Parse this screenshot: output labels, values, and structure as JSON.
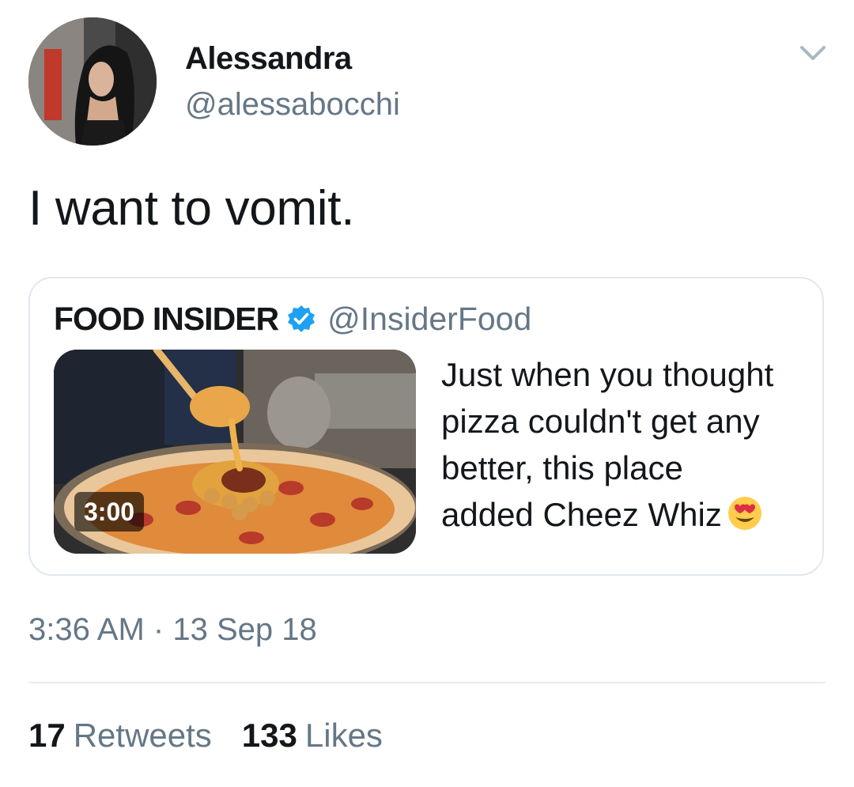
{
  "author": {
    "display_name": "Alessandra",
    "handle": "@alessabocchi",
    "avatar_icon": "profile-photo"
  },
  "menu_icon": "chevron-down-icon",
  "tweet": {
    "text": "I want to vomit."
  },
  "quoted_tweet": {
    "author_name": "FOOD INSIDER",
    "verified": true,
    "verified_icon": "verified-badge-icon",
    "handle": "@InsiderFood",
    "media": {
      "type": "video",
      "duration": "3:00",
      "description_icon": "pizza-video-thumbnail"
    },
    "text_lines": [
      "Just when you thought",
      "pizza couldn't get any",
      "better, this place",
      "added Cheez Whiz"
    ],
    "emoji": "heart-eyes-emoji"
  },
  "timestamp": {
    "time": "3:36 AM",
    "separator": "·",
    "date": "13 Sep 18"
  },
  "stats": {
    "retweets_count": "17",
    "retweets_label": "Retweets",
    "likes_count": "133",
    "likes_label": "Likes"
  },
  "colors": {
    "text_primary": "#14171a",
    "text_secondary": "#657786",
    "border": "#e1e8ed",
    "verified_blue": "#1da1f2"
  }
}
